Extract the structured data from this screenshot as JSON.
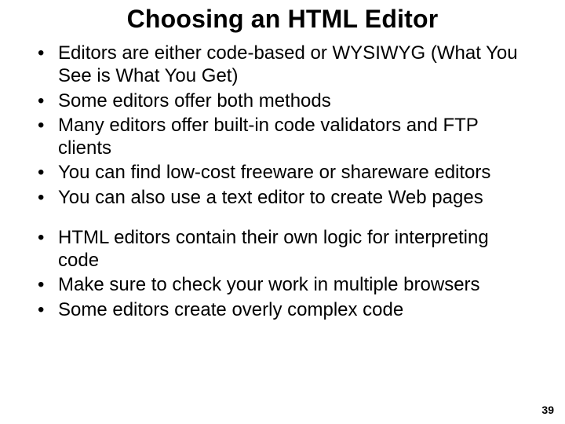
{
  "title": "Choosing an HTML Editor",
  "group1": [
    "Editors are either code-based or WYSIWYG (What You See is What You Get)",
    "Some editors offer both methods",
    "Many editors offer built-in code validators and FTP clients",
    "You can find low-cost freeware or shareware editors",
    "You can also use a text editor to create Web pages"
  ],
  "group2": [
    "HTML editors contain their own logic for interpreting code",
    "Make sure to check your work in multiple browsers",
    "Some editors create overly complex code"
  ],
  "page_number": "39"
}
